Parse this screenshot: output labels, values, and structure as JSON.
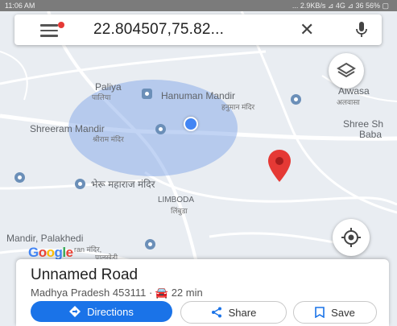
{
  "statusbar": {
    "time": "11:06 AM",
    "right": "... 2.9KB/s ⊿ 4G ⊿ 36 56% ▢"
  },
  "search": {
    "query": "22.804507,75.82..."
  },
  "map": {
    "labels": [
      {
        "id": "paliya",
        "text": "Paliya"
      },
      {
        "id": "paliya-hi",
        "text": "पालिया"
      },
      {
        "id": "hanuman",
        "text": "Hanuman Mandir"
      },
      {
        "id": "hanuman-hi",
        "text": "हनुमान मंदिर"
      },
      {
        "id": "alwasa",
        "text": "Alwasa"
      },
      {
        "id": "alwasa-hi",
        "text": "अलवासा"
      },
      {
        "id": "shreeram",
        "text": "Shreeram Mandir"
      },
      {
        "id": "shreeram-hi",
        "text": "श्रीराम मंदिर"
      },
      {
        "id": "shree-baba",
        "text": "Shree Sh"
      },
      {
        "id": "shree-baba-2",
        "text": "Baba"
      },
      {
        "id": "bheru",
        "text": "भेरू महाराज मंदिर"
      },
      {
        "id": "limboda",
        "text": "LIMBODA"
      },
      {
        "id": "limboda-hi",
        "text": "लिंबुडा"
      },
      {
        "id": "palakhedi",
        "text": "Mandir, Palakhedi"
      },
      {
        "id": "palakhedi-hi",
        "text": "ran मंदिर,"
      },
      {
        "id": "palakhedi-hi-2",
        "text": "पालखेड़ी"
      }
    ],
    "google_logo": "Google"
  },
  "sheet": {
    "title": "Unnamed Road",
    "subtitle": "Madhya Pradesh 453111 · 🚘 22 min",
    "buttons": {
      "directions": "Directions",
      "share": "Share",
      "save": "Save"
    }
  },
  "colors": {
    "accent": "#1a73e8",
    "pin": "#e53935",
    "poi": "#6b8fb8"
  }
}
